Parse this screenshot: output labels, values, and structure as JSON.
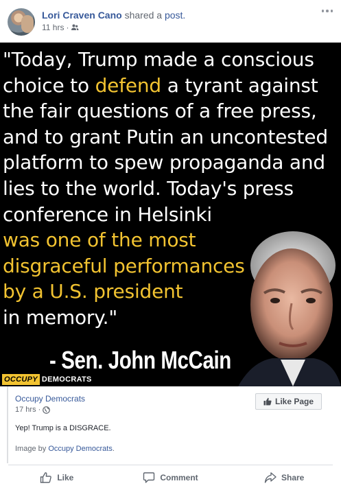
{
  "header": {
    "author": "Lori Craven Cano",
    "action": "shared a",
    "post_link": "post.",
    "time": "11 hrs",
    "separator": "·",
    "audience_icon": "friends-icon",
    "menu_icon": "more-options-icon"
  },
  "quote_image": {
    "line1": "\"Today, Trump made a conscious",
    "line2a": "choice to ",
    "line2b": "defend",
    "line2c": " a tyrant against",
    "line3": "the fair questions of a free press,",
    "line4": "and to grant Putin an uncontested",
    "line5": "platform to spew propaganda and",
    "line6": "lies to the world. Today's press",
    "line7": "conference in Helsinki",
    "line8": "was one of the most",
    "line9": "disgraceful performances",
    "line10": "by a U.S. president",
    "line11": "in memory.\"",
    "signature": "- Sen. John McCain",
    "logo_part1": "OCCUPY",
    "logo_part2": "DEMOCRATS",
    "colors": {
      "background": "#000000",
      "text": "#ffffff",
      "highlight": "#f2c331"
    }
  },
  "shared_card": {
    "page_name": "Occupy Democrats",
    "time": "17 hrs",
    "separator": "·",
    "audience_icon": "globe-icon",
    "like_page_label": "Like Page",
    "text": "Yep! Trump is a DISGRACE.",
    "attribution_prefix": "Image by ",
    "attribution_link": "Occupy Democrats",
    "attribution_suffix": "."
  },
  "actions": {
    "like": "Like",
    "comment": "Comment",
    "share": "Share"
  },
  "colors": {
    "link": "#365899",
    "muted": "#616770",
    "action": "#606770"
  }
}
